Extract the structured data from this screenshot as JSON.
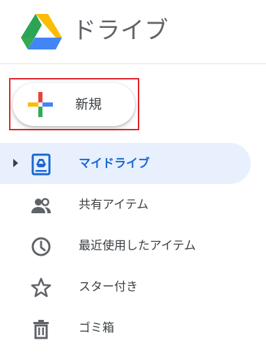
{
  "header": {
    "title": "ドライブ",
    "logo_icon": "google-drive-logo"
  },
  "new_button": {
    "label": "新規",
    "icon": "plus-icon",
    "highlight_color": "#e0222a"
  },
  "nav": {
    "items": [
      {
        "label": "マイドライブ",
        "icon": "my-drive-icon",
        "active": true,
        "expandable": true
      },
      {
        "label": "共有アイテム",
        "icon": "people-icon",
        "active": false
      },
      {
        "label": "最近使用したアイテム",
        "icon": "clock-icon",
        "active": false
      },
      {
        "label": "スター付き",
        "icon": "star-icon",
        "active": false
      },
      {
        "label": "ゴミ箱",
        "icon": "trash-icon",
        "active": false
      }
    ]
  },
  "colors": {
    "accent": "#1967d2",
    "active_bg": "#e8f0fe",
    "text": "#3c4043",
    "icon": "#5f6368"
  }
}
